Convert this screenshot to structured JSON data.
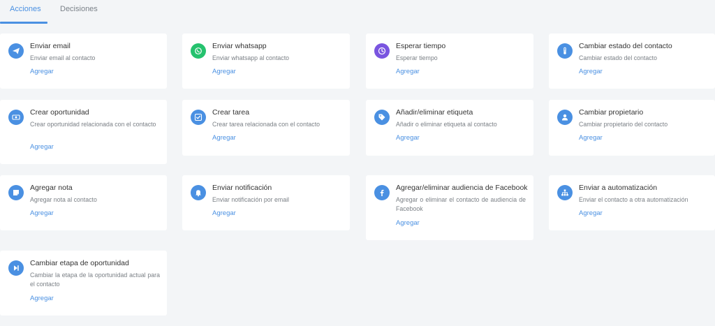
{
  "tabs": [
    {
      "label": "Acciones"
    },
    {
      "label": "Decisiones"
    }
  ],
  "colors": {
    "accent": "#4a90e2",
    "whatsapp": "#25c26e",
    "timer": "#7a55e0"
  },
  "cards": [
    {
      "title": "Enviar email",
      "desc": "Enviar email al contacto",
      "action": "Agregar",
      "icon": "paper-plane-icon"
    },
    {
      "title": "Enviar whatsapp",
      "desc": "Enviar whatsapp al contacto",
      "action": "Agregar",
      "icon": "whatsapp-icon"
    },
    {
      "title": "Esperar tiempo",
      "desc": "Esperar tiempo",
      "action": "Agregar",
      "icon": "clock-icon"
    },
    {
      "title": "Cambiar estado del contacto",
      "desc": "Cambiar estado del contacto",
      "action": "Agregar",
      "icon": "thermometer-icon"
    },
    {
      "title": "Crear oportunidad",
      "desc": "Crear oportunidad relacionada con el contacto",
      "action": "Agregar",
      "icon": "money-icon"
    },
    {
      "title": "Crear tarea",
      "desc": "Crear tarea relacionada con el contacto",
      "action": "Agregar",
      "icon": "checkbox-icon"
    },
    {
      "title": "Añadir/eliminar etiqueta",
      "desc": "Añadir o eliminar etiqueta al contacto",
      "action": "Agregar",
      "icon": "tag-icon"
    },
    {
      "title": "Cambiar propietario",
      "desc": "Cambiar propietario del contacto",
      "action": "Agregar",
      "icon": "user-icon"
    },
    {
      "title": "Agregar nota",
      "desc": "Agregar nota al contacto",
      "action": "Agregar",
      "icon": "note-icon"
    },
    {
      "title": "Enviar notificación",
      "desc": "Enviar notificación por email",
      "action": "Agregar",
      "icon": "bell-icon"
    },
    {
      "title": "Agregar/eliminar audiencia de Facebook",
      "desc": "Agregar o eliminar el contacto de audiencia de Facebook",
      "action": "Agregar",
      "icon": "facebook-icon"
    },
    {
      "title": "Enviar a automatización",
      "desc": "Enviar el contacto a otra automatización",
      "action": "Agregar",
      "icon": "sitemap-icon"
    },
    {
      "title": "Cambiar etapa de oportunidad",
      "desc": "Cambiar la etapa de la oportunidad actual para el contacto",
      "action": "Agregar",
      "icon": "skip-forward-icon"
    }
  ]
}
